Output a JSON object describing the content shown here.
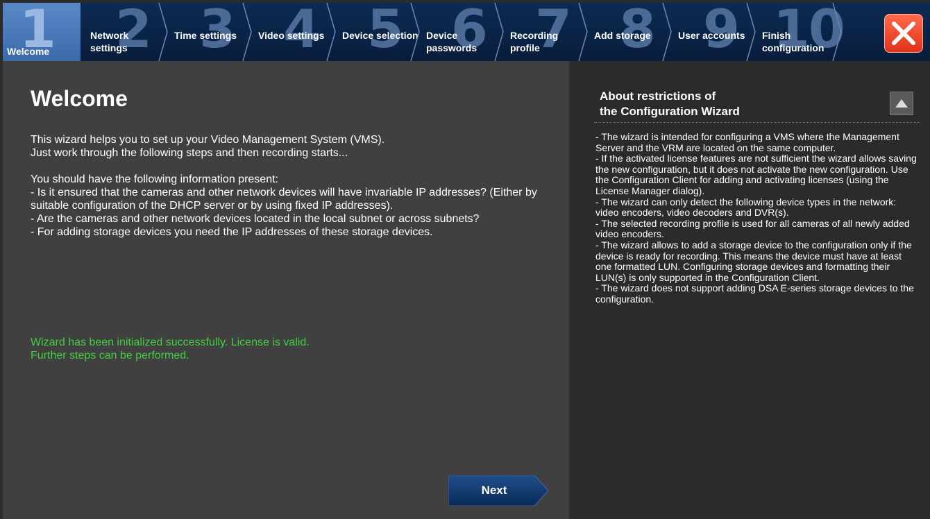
{
  "steps": [
    {
      "num": "1",
      "label": "Welcome"
    },
    {
      "num": "2",
      "label": "Network settings"
    },
    {
      "num": "3",
      "label": "Time settings"
    },
    {
      "num": "4",
      "label": "Video settings"
    },
    {
      "num": "5",
      "label": "Device selection"
    },
    {
      "num": "6",
      "label": "Device passwords"
    },
    {
      "num": "7",
      "label": "Recording profile"
    },
    {
      "num": "8",
      "label": "Add storage"
    },
    {
      "num": "9",
      "label": "User accounts"
    },
    {
      "num": "10",
      "label": "Finish configuration"
    }
  ],
  "close_icon": "close-x-icon",
  "main": {
    "title": "Welcome",
    "intro": [
      "This wizard helps you to set up your Video Management System (VMS).",
      "Just work through the following steps and then recording starts..."
    ],
    "info_header": "You should have the following information present:",
    "info_items": [
      "-  Is it ensured that the cameras and other network devices will have invariable IP addresses? (Either by suitable configuration of the DHCP server or by using fixed IP addresses).",
      "-  Are the cameras and other network devices located in the local subnet or across subnets?",
      "-  For adding storage devices you need the IP addresses of these storage devices."
    ],
    "status": [
      "Wizard has been initialized successfully. License is valid.",
      "Further steps can be performed."
    ],
    "next_label": "Next"
  },
  "side": {
    "title_line1": "About restrictions of",
    "title_line2": "the Configuration Wizard",
    "collapse_icon": "chevron-up-icon",
    "items": [
      "- The wizard is intended for configuring a VMS where the Management Server and the VRM are located on the same computer.",
      "- If the activated license features are not sufficient the wizard allows saving the new configuration, but it does not activate the new configuration. Use the Configuration Client for adding and activating licenses  (using the License Manager dialog).",
      "- The wizard can only detect the following device types in the network: video encoders, video decoders and DVR(s).",
      "- The selected recording profile is used for all cameras of all newly added video encoders.",
      "- The wizard allows to add a storage device to the configuration only if the device is ready for recording. This means the device must have at least one formatted LUN. Configuring storage devices and formatting their LUN(s) is only supported in the Configuration Client.",
      "- The wizard does not support adding DSA E-series storage devices to the configuration."
    ]
  },
  "colors": {
    "stepbar": "#0a2346",
    "active_step": "#4a7ab8",
    "status_green": "#40d040",
    "close_red": "#f04a2a"
  }
}
